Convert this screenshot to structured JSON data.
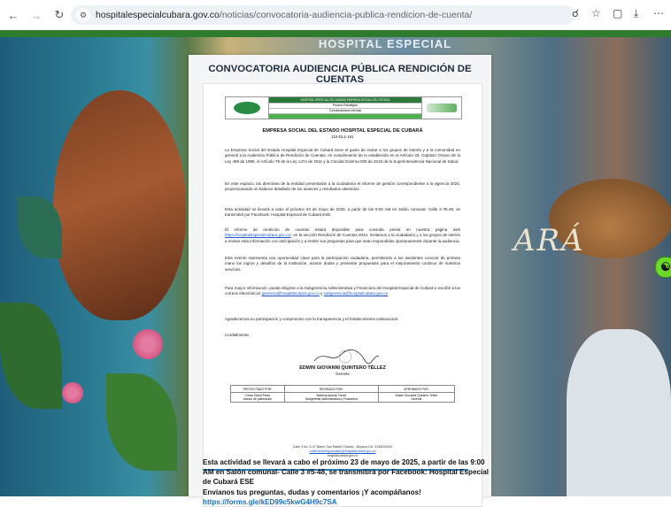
{
  "browser": {
    "back_icon": "arrow-left-icon",
    "forward_icon": "arrow-right-icon",
    "reload_icon": "reload-icon",
    "site_icon": "site-info-icon",
    "url_domain": "hospitalespecialcubara.gov.co",
    "url_path": "/noticias/convocatoria-audiencia-publica-rendicion-de-cuenta/"
  },
  "background": {
    "watermark_text": "HOSPITAL ESPECIAL",
    "mural_text": "ARÁ"
  },
  "card": {
    "title": "CONVOCATORIA AUDIENCIA PÚBLICA RENDICIÓN DE CUENTAS"
  },
  "document": {
    "header_row1": "HOSPITAL ESPECIAL DE CUBARÁ EMPRESA SOCIAL DEL ESTADO",
    "header_row2": "Proceso Estratégico",
    "header_row3": "Comunicaciones Internas",
    "heading": "EMPRESA SOCIAL DEL ESTADO HOSPITAL ESPECIAL DE CUBARÁ",
    "subheading": "110-DL1-161",
    "para1": "La Empresa Social del Estado Hospital Especial de Cubará tiene el gusto de invitar a los grupos de interés y a la comunidad en general a la Audiencia Pública de Rendición de Cuentas, en cumplimiento de lo establecido en el Artículo 33, Capítulo Octavo de la Ley 489 de 1998, el Artículo 78 de la Ley 1474 de 2011 y la Circular Externa 008 de 2018 de la Superintendencia Nacional de Salud.",
    "para2": "En este espacio, las directivas de la entidad presentarán a la ciudadanía el informe de gestión correspondiente a la vigencia 2024, proporcionando un balance detallado de los avances y resultados obtenidos.",
    "para3": "Esta actividad se llevará a cabo el próximo 23 de mayo de 2025, a partir de las 9:00 AM en Salón comunal- Calle 3 #5-48, se transmitirá por Facebook: Hospital Especial de Cubará ESE.",
    "para4a": "El informe de rendición de cuentas estará disponible para consulta previa en nuestra página web",
    "para4_link": "https://hospitalespecialcubara.gov.co/",
    "para4b": ", en la sección Rendición de Cuentas 2024. Invitamos a la ciudadanía y a los grupos de interés a revisar esta información con anticipación y a remitir sus preguntas para que sean respondidas oportunamente durante la audiencia.",
    "para5": "Este evento representa una oportunidad clave para la participación ciudadana, permitiendo a los asistentes conocer de primera mano los logros y desafíos de la institución, aclarar dudas y presentar propuestas para el mejoramiento continuo de nuestros servicios.",
    "para6a": "Para mayor información, puede dirigirse a la Subgerencia Administrativa y Financiera del Hospital Especial de Cubará o escribir a los correos electrónicos",
    "para6_link1": "gerencia@hospitalcubara.gov.co",
    "para6_y": "y",
    "para6_link2": "subgerencia@hospitalcubara.gov.co",
    "para7": "Agradecemos su participación y compromiso con la transparencia y el fortalecimiento institucional.",
    "closing": "Cordialmente,",
    "signer_name": "EDWIN GIOVANNI QUINTERO TÉLLEZ",
    "signer_role": "Gerente",
    "table_headers": [
      "PROYECTADO POR:",
      "REVISADO POR:",
      "APROBADO POR:"
    ],
    "table_row1": [
      "Cesar David Parra",
      "Marleny Aponte Torres",
      "Edwin Giovanni Quintero Téllez"
    ],
    "table_row2": [
      "Asesor de planeación",
      "Subgerente Administrativa y Financiera",
      "Gerente"
    ],
    "footer_line1": "Calle 3 No. 5-47 Barrio San Rafael Cubará – Boyacá   Cel. 3138204042",
    "footer_link": "notificacionesjudiciales@hospitalcubara.gov.co",
    "footer_line3": "hospitalcubara.gov.co"
  },
  "caption": {
    "line1": "Esta actividad se llevará a cabo el próximo 23 de mayo de 2025, a partir de las 9:00 AM en Salón comunal- Calle 3 #5-48, se transmitirá por Facebook: Hospital Especial de Cubará ESE",
    "line2": "Envíanos tus preguntas, dudas y comentarios ¡Y acompáñanos!",
    "link": "https://forms.gle/kED99c5kwG4H9c7SA"
  },
  "colors": {
    "green_bar": "#2e7d2e",
    "link": "#1a6fc9",
    "accessibility": "#6bd82a"
  }
}
